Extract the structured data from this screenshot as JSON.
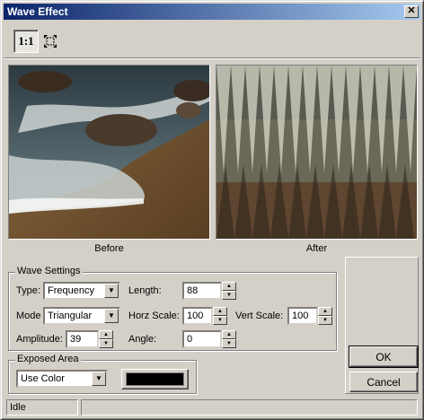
{
  "window": {
    "title": "Wave Effect",
    "close_glyph": "✕"
  },
  "toolbar": {
    "zoom_1to1_label": "1:1",
    "fit_icon": "fit-to-window-icon"
  },
  "preview": {
    "before_label": "Before",
    "after_label": "After"
  },
  "wave_settings": {
    "title": "Wave Settings",
    "type_label": "Type:",
    "type_value": "Frequency",
    "mode_label": "Mode",
    "mode_value": "Triangular",
    "amplitude_label": "Amplitude:",
    "amplitude_value": "39",
    "length_label": "Length:",
    "length_value": "88",
    "horz_scale_label": "Horz Scale:",
    "horz_scale_value": "100",
    "vert_scale_label": "Vert Scale:",
    "vert_scale_value": "100",
    "angle_label": "Angle:",
    "angle_value": "0"
  },
  "exposed_area": {
    "title": "Exposed Area",
    "fill_value": "Use Color",
    "color_swatch": "#000000"
  },
  "buttons": {
    "ok": "OK",
    "cancel": "Cancel"
  },
  "status": {
    "text": "Idle"
  },
  "colors": {
    "titlebar_start": "#0a246a",
    "titlebar_end": "#a6caf0",
    "face": "#d4d0c8"
  }
}
